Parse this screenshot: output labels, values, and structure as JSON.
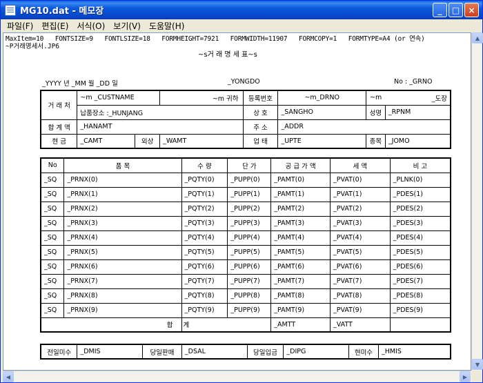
{
  "window": {
    "title": "MG10.dat - 메모장",
    "min": "_",
    "max": "□",
    "close": "×"
  },
  "menu": [
    "파일(F)",
    "편집(E)",
    "서식(O)",
    "보기(V)",
    "도움말(H)"
  ],
  "header": {
    "line1": "MaxItem=10   FONTSIZE=9   FONTLSIZE=18   FORMHEIGHT=7921   FORMWIDTH=11907   FORMCOPY=1   FORMTYPE=A4 (or 연속)",
    "line2": "~P거래명세서.JP6",
    "form_title": "~s거 래 명 세 표~s"
  },
  "topline": {
    "date": "_YYYY 년  _MM 월  _DD 일",
    "yongdo": "_YONGDO",
    "no": "No :  _GRNO"
  },
  "info": {
    "georaecheo": "거 래 처",
    "custname": "~m  _CUSTNAME",
    "m_gwiha": "~m     귀하",
    "napum": "납품장소 :_HUNJANG",
    "deungrok": "등록번호",
    "drno": "~m_DRNO",
    "m2": "~m",
    "dojang": "_도장",
    "sangho_label": "상     호",
    "sangho": "_SANGHO",
    "seongmyeong": "성명",
    "rpnm": "_RPNM",
    "hapgye_label": "합 계 액",
    "hanamt": "_HANAMT",
    "juso_label": "주     소",
    "addr": "_ADDR",
    "hyeongeum_label": "현       금",
    "camt": "_CAMT",
    "oesang_label": "외상",
    "wamt": "_WAMT",
    "eoptae_label": "업     태",
    "upte": "_UPTE",
    "jongmok_label": "종목",
    "jomo": "_JOMO"
  },
  "items": {
    "headers": [
      "No",
      "품            목",
      "수  량",
      "단  가",
      "공 급 가 액",
      "세      액",
      "비    고"
    ],
    "rows": [
      [
        "_SQ",
        "_PRNX(0)",
        "_PQTY(0)",
        "_PUPP(0)",
        "_PAMT(0)",
        "_PVAT(0)",
        "_PLNK(0)"
      ],
      [
        "_SQ",
        "_PRNX(1)",
        "_PQTY(1)",
        "_PUPP(1)",
        "_PAMT(1)",
        "_PVAT(1)",
        "_PDES(1)"
      ],
      [
        "_SQ",
        "_PRNX(2)",
        "_PQTY(2)",
        "_PUPP(2)",
        "_PAMT(2)",
        "_PVAT(2)",
        "_PDES(2)"
      ],
      [
        "_SQ",
        "_PRNX(3)",
        "_PQTY(3)",
        "_PUPP(3)",
        "_PAMT(3)",
        "_PVAT(3)",
        "_PDES(3)"
      ],
      [
        "_SQ",
        "_PRNX(4)",
        "_PQTY(4)",
        "_PUPP(4)",
        "_PAMT(4)",
        "_PVAT(4)",
        "_PDES(4)"
      ],
      [
        "_SQ",
        "_PRNX(5)",
        "_PQTY(5)",
        "_PUPP(5)",
        "_PAMT(5)",
        "_PVAT(5)",
        "_PDES(5)"
      ],
      [
        "_SQ",
        "_PRNX(6)",
        "_PQTY(6)",
        "_PUPP(6)",
        "_PAMT(6)",
        "_PVAT(6)",
        "_PDES(6)"
      ],
      [
        "_SQ",
        "_PRNX(7)",
        "_PQTY(7)",
        "_PUPP(7)",
        "_PAMT(7)",
        "_PVAT(7)",
        "_PDES(7)"
      ],
      [
        "_SQ",
        "_PRNX(8)",
        "_PQTY(8)",
        "_PUPP(8)",
        "_PAMT(8)",
        "_PVAT(8)",
        "_PDES(8)"
      ],
      [
        "_SQ",
        "_PRNX(9)",
        "_PQTY(9)",
        "_PUPP(9)",
        "_PAMT(9)",
        "_PVAT(9)",
        "_PDES(9)"
      ]
    ],
    "total_hap": "합",
    "total_gye": "계",
    "amtt": "_AMTT",
    "vatt": "_VATT"
  },
  "footer": {
    "jeonil_label": "전일미수",
    "dmis": "_DMIS",
    "dangil_label": "당일판매",
    "dsal": "_DSAL",
    "dangilip_label": "당일입금",
    "dipg": "_DIPG",
    "hyeonmisu_label": "현미수",
    "hmis": "_HMIS"
  }
}
